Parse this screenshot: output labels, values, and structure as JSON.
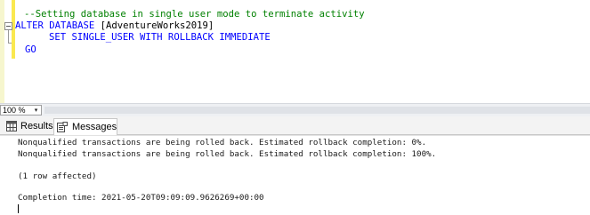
{
  "editor": {
    "line1": "--Setting database in single user mode to terminate activity",
    "line2_kw": "ALTER DATABASE",
    "line2_obj": " [AdventureWorks2019]",
    "line3": "SET SINGLE_USER WITH ROLLBACK IMMEDIATE",
    "line4": "GO"
  },
  "zoom": {
    "value": "100 %",
    "arrow": "▾"
  },
  "tabs": {
    "results_label": "Results",
    "messages_label": "Messages",
    "active": "Messages"
  },
  "messages": {
    "lines": [
      "Nonqualified transactions are being rolled back. Estimated rollback completion: 0%.",
      "Nonqualified transactions are being rolled back. Estimated rollback completion: 100%.",
      "(1 row affected)",
      "Completion time: 2021-05-20T09:09:09.9626269+00:00"
    ]
  },
  "colors": {
    "comment": "#008000",
    "keyword": "#0000ff",
    "change_marker": "#fae84f"
  }
}
